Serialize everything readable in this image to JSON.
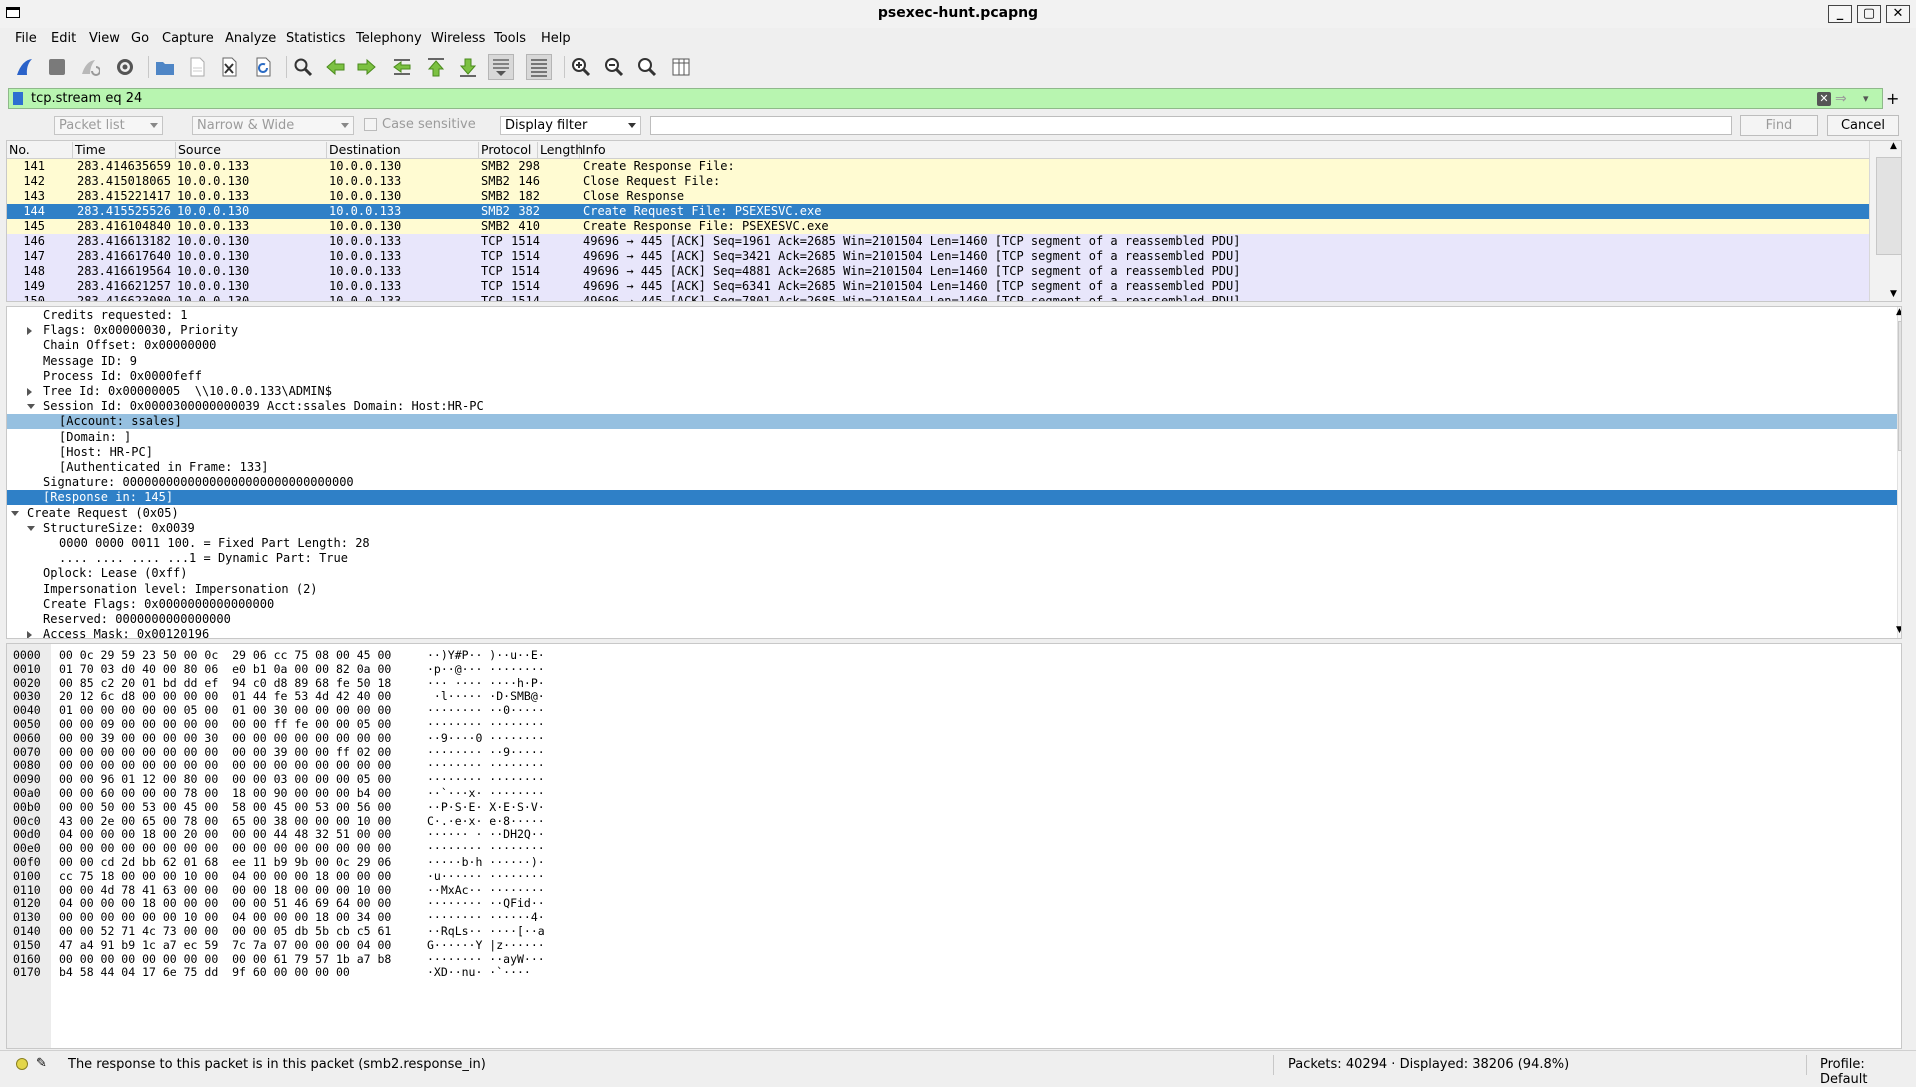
{
  "window": {
    "title": "psexec-hunt.pcapng"
  },
  "menu": [
    "File",
    "Edit",
    "View",
    "Go",
    "Capture",
    "Analyze",
    "Statistics",
    "Telephony",
    "Wireless",
    "Tools",
    "Help"
  ],
  "toolbar": {
    "icons": [
      "shark-fin-start-icon",
      "stop-icon",
      "restart-icon",
      "gear-options-icon",
      "open-folder-icon",
      "save-file-icon",
      "close-file-icon",
      "reload-icon",
      "find-icon",
      "go-back-icon",
      "go-forward-icon",
      "go-to-packet-icon",
      "first-packet-icon",
      "last-packet-icon",
      "autoscroll-icon",
      "colorize-icon",
      "zoom-in-icon",
      "zoom-out-icon",
      "zoom-normal-icon",
      "resize-columns-icon"
    ]
  },
  "filter": {
    "value": "tcp.stream eq 24"
  },
  "findbar": {
    "search_in": "Packet list",
    "char_width": "Narrow & Wide",
    "case_sensitive": "Case sensitive",
    "search_type": "Display filter",
    "find_label": "Find",
    "cancel_label": "Cancel"
  },
  "packet_list": {
    "columns": [
      "No.",
      "Time",
      "Source",
      "Destination",
      "Protocol",
      "Length",
      "Info"
    ],
    "rows": [
      {
        "no": "141",
        "time": "283.414635659",
        "src": "10.0.0.133",
        "dst": "10.0.0.130",
        "proto": "SMB2",
        "len": "298",
        "info": "Create Response File:",
        "kind": "smb"
      },
      {
        "no": "142",
        "time": "283.415018065",
        "src": "10.0.0.130",
        "dst": "10.0.0.133",
        "proto": "SMB2",
        "len": "146",
        "info": "Close Request File:",
        "kind": "smb"
      },
      {
        "no": "143",
        "time": "283.415221417",
        "src": "10.0.0.133",
        "dst": "10.0.0.130",
        "proto": "SMB2",
        "len": "182",
        "info": "Close Response",
        "kind": "smb"
      },
      {
        "no": "144",
        "time": "283.415525526",
        "src": "10.0.0.130",
        "dst": "10.0.0.133",
        "proto": "SMB2",
        "len": "382",
        "info": "Create Request File: PSEXESVC.exe",
        "kind": "sel"
      },
      {
        "no": "145",
        "time": "283.416104840",
        "src": "10.0.0.133",
        "dst": "10.0.0.130",
        "proto": "SMB2",
        "len": "410",
        "info": "Create Response File: PSEXESVC.exe",
        "kind": "smb"
      },
      {
        "no": "146",
        "time": "283.416613182",
        "src": "10.0.0.130",
        "dst": "10.0.0.133",
        "proto": "TCP",
        "len": "1514",
        "info": "49696 → 445 [ACK] Seq=1961 Ack=2685 Win=2101504 Len=1460 [TCP segment of a reassembled PDU]",
        "kind": "tcp"
      },
      {
        "no": "147",
        "time": "283.416617640",
        "src": "10.0.0.130",
        "dst": "10.0.0.133",
        "proto": "TCP",
        "len": "1514",
        "info": "49696 → 445 [ACK] Seq=3421 Ack=2685 Win=2101504 Len=1460 [TCP segment of a reassembled PDU]",
        "kind": "tcp"
      },
      {
        "no": "148",
        "time": "283.416619564",
        "src": "10.0.0.130",
        "dst": "10.0.0.133",
        "proto": "TCP",
        "len": "1514",
        "info": "49696 → 445 [ACK] Seq=4881 Ack=2685 Win=2101504 Len=1460 [TCP segment of a reassembled PDU]",
        "kind": "tcp"
      },
      {
        "no": "149",
        "time": "283.416621257",
        "src": "10.0.0.130",
        "dst": "10.0.0.133",
        "proto": "TCP",
        "len": "1514",
        "info": "49696 → 445 [ACK] Seq=6341 Ack=2685 Win=2101504 Len=1460 [TCP segment of a reassembled PDU]",
        "kind": "tcp"
      },
      {
        "no": "150",
        "time": "283.416623080",
        "src": "10.0.0.130",
        "dst": "10.0.0.133",
        "proto": "TCP",
        "len": "1514",
        "info": "49696 → 445 [ACK] Seq=7801 Ack=2685 Win=2101504 Len=1460 [TCP segment of a reassembled PDU]",
        "kind": "tcp"
      }
    ]
  },
  "details": [
    {
      "text": "Credits requested: 1",
      "indent": 3,
      "exp": "none",
      "state": ""
    },
    {
      "text": "Flags: 0x00000030, Priority",
      "indent": 3,
      "exp": "closed",
      "state": ""
    },
    {
      "text": "Chain Offset: 0x00000000",
      "indent": 3,
      "exp": "none",
      "state": ""
    },
    {
      "text": "Message ID: 9",
      "indent": 3,
      "exp": "none",
      "state": ""
    },
    {
      "text": "Process Id: 0x0000feff",
      "indent": 3,
      "exp": "none",
      "state": ""
    },
    {
      "text": "Tree Id: 0x00000005  \\\\10.0.0.133\\ADMIN$",
      "indent": 3,
      "exp": "closed",
      "state": ""
    },
    {
      "text": "Session Id: 0x0000300000000039 Acct:ssales Domain: Host:HR-PC",
      "indent": 3,
      "exp": "open",
      "state": ""
    },
    {
      "text": "[Account: ssales]",
      "indent": 4,
      "exp": "none",
      "state": "hl"
    },
    {
      "text": "[Domain: ]",
      "indent": 4,
      "exp": "none",
      "state": ""
    },
    {
      "text": "[Host: HR-PC]",
      "indent": 4,
      "exp": "none",
      "state": ""
    },
    {
      "text": "[Authenticated in Frame: 133]",
      "indent": 4,
      "exp": "none",
      "state": ""
    },
    {
      "text": "Signature: 00000000000000000000000000000000",
      "indent": 3,
      "exp": "none",
      "state": ""
    },
    {
      "text": "[Response in: 145]",
      "indent": 3,
      "exp": "none",
      "state": "sel"
    },
    {
      "text": "Create Request (0x05)",
      "indent": 2,
      "exp": "open",
      "state": ""
    },
    {
      "text": "StructureSize: 0x0039",
      "indent": 3,
      "exp": "open",
      "state": ""
    },
    {
      "text": "0000 0000 0011 100. = Fixed Part Length: 28",
      "indent": 4,
      "exp": "none",
      "state": ""
    },
    {
      "text": ".... .... .... ...1 = Dynamic Part: True",
      "indent": 4,
      "exp": "none",
      "state": ""
    },
    {
      "text": "Oplock: Lease (0xff)",
      "indent": 3,
      "exp": "none",
      "state": ""
    },
    {
      "text": "Impersonation level: Impersonation (2)",
      "indent": 3,
      "exp": "none",
      "state": ""
    },
    {
      "text": "Create Flags: 0x0000000000000000",
      "indent": 3,
      "exp": "none",
      "state": ""
    },
    {
      "text": "Reserved: 0000000000000000",
      "indent": 3,
      "exp": "none",
      "state": ""
    },
    {
      "text": "Access Mask: 0x00120196",
      "indent": 3,
      "exp": "closed",
      "state": ""
    }
  ],
  "bytes": [
    {
      "off": "0000",
      "hex": "00 0c 29 59 23 50 00 0c  29 06 cc 75 08 00 45 00",
      "ascii": "··)Y#P·· )··u··E·"
    },
    {
      "off": "0010",
      "hex": "01 70 03 d0 40 00 80 06  e0 b1 0a 00 00 82 0a 00",
      "ascii": "·p··@··· ········"
    },
    {
      "off": "0020",
      "hex": "00 85 c2 20 01 bd dd ef  94 c0 d8 89 68 fe 50 18",
      "ascii": "··· ···· ····h·P·"
    },
    {
      "off": "0030",
      "hex": "20 12 6c d8 00 00 00 00  01 44 fe 53 4d 42 40 00",
      "ascii": " ·l····· ·D·SMB@·"
    },
    {
      "off": "0040",
      "hex": "01 00 00 00 00 00 05 00  01 00 30 00 00 00 00 00",
      "ascii": "········ ··0·····"
    },
    {
      "off": "0050",
      "hex": "00 00 09 00 00 00 00 00  00 00 ff fe 00 00 05 00",
      "ascii": "········ ········"
    },
    {
      "off": "0060",
      "hex": "00 00 39 00 00 00 00 30  00 00 00 00 00 00 00 00",
      "ascii": "··9····0 ········"
    },
    {
      "off": "0070",
      "hex": "00 00 00 00 00 00 00 00  00 00 39 00 00 ff 02 00",
      "ascii": "········ ··9·····"
    },
    {
      "off": "0080",
      "hex": "00 00 00 00 00 00 00 00  00 00 00 00 00 00 00 00",
      "ascii": "········ ········"
    },
    {
      "off": "0090",
      "hex": "00 00 96 01 12 00 80 00  00 00 03 00 00 00 05 00",
      "ascii": "········ ········"
    },
    {
      "off": "00a0",
      "hex": "00 00 60 00 00 00 78 00  18 00 90 00 00 00 b4 00",
      "ascii": "··`···x· ········"
    },
    {
      "off": "00b0",
      "hex": "00 00 50 00 53 00 45 00  58 00 45 00 53 00 56 00",
      "ascii": "··P·S·E· X·E·S·V·"
    },
    {
      "off": "00c0",
      "hex": "43 00 2e 00 65 00 78 00  65 00 38 00 00 00 10 00",
      "ascii": "C·.·e·x· e·8·····"
    },
    {
      "off": "00d0",
      "hex": "04 00 00 00 18 00 20 00  00 00 44 48 32 51 00 00",
      "ascii": "······ · ··DH2Q··"
    },
    {
      "off": "00e0",
      "hex": "00 00 00 00 00 00 00 00  00 00 00 00 00 00 00 00",
      "ascii": "········ ········"
    },
    {
      "off": "00f0",
      "hex": "00 00 cd 2d bb 62 01 68  ee 11 b9 9b 00 0c 29 06",
      "ascii": "·····b·h ······)·"
    },
    {
      "off": "0100",
      "hex": "cc 75 18 00 00 00 10 00  04 00 00 00 18 00 00 00",
      "ascii": "·u······ ········"
    },
    {
      "off": "0110",
      "hex": "00 00 4d 78 41 63 00 00  00 00 18 00 00 00 10 00",
      "ascii": "··MxAc·· ········"
    },
    {
      "off": "0120",
      "hex": "04 00 00 00 18 00 00 00  00 00 51 46 69 64 00 00",
      "ascii": "········ ··QFid··"
    },
    {
      "off": "0130",
      "hex": "00 00 00 00 00 00 10 00  04 00 00 00 18 00 34 00",
      "ascii": "········ ······4·"
    },
    {
      "off": "0140",
      "hex": "00 00 52 71 4c 73 00 00  00 00 05 db 5b cb c5 61",
      "ascii": "··RqLs·· ····[··a"
    },
    {
      "off": "0150",
      "hex": "47 a4 91 b9 1c a7 ec 59  7c 7a 07 00 00 00 04 00",
      "ascii": "G······Y |z······"
    },
    {
      "off": "0160",
      "hex": "00 00 00 00 00 00 00 00  00 00 61 79 57 1b a7 b8",
      "ascii": "········ ··ayW···"
    },
    {
      "off": "0170",
      "hex": "b4 58 44 04 17 6e 75 dd  9f 60 00 00 00 00",
      "ascii": "·XD··nu· ·`····"
    }
  ],
  "status": {
    "message": "The response to this packet is in this packet (smb2.response_in)",
    "packets": "Packets: 40294 · Displayed: 38206 (94.8%)",
    "profile": "Profile: Default"
  }
}
